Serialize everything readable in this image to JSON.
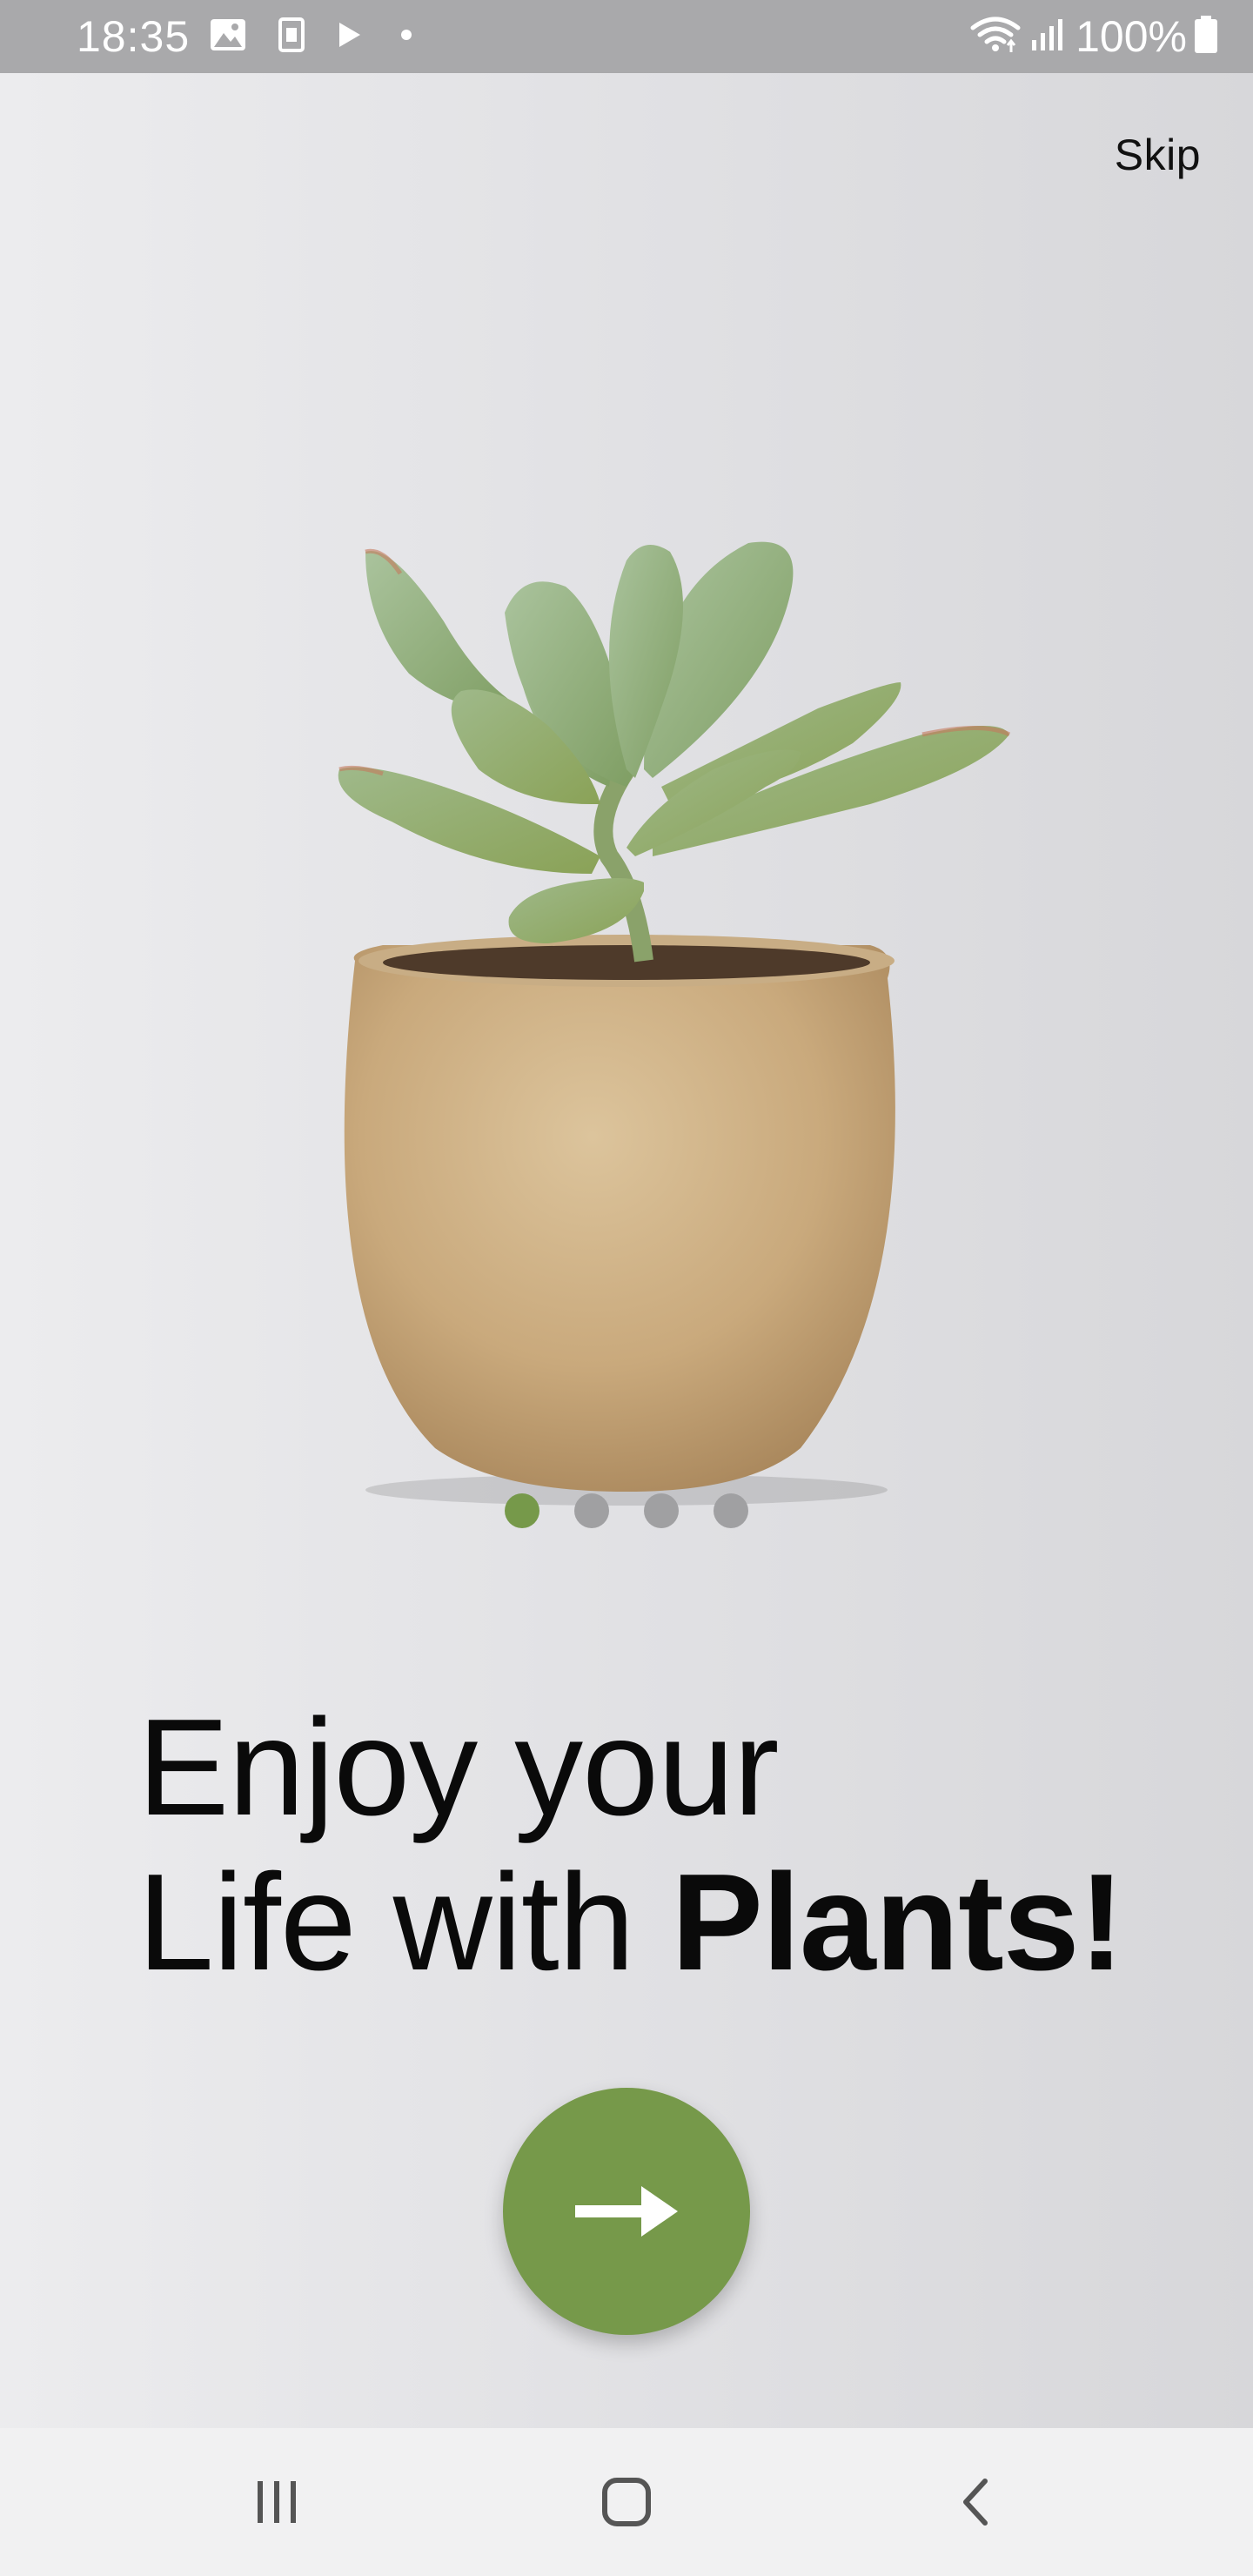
{
  "status_bar": {
    "time": "18:35",
    "battery": "100%",
    "icons": [
      "gallery-icon",
      "notification-app-icon",
      "play-icon",
      "dot-icon",
      "wifi-icon",
      "signal-icon",
      "battery-icon"
    ]
  },
  "onboarding": {
    "skip_label": "Skip",
    "headline_line1": "Enjoy your",
    "headline_line2_regular": "Life with ",
    "headline_line2_bold": "Plants!",
    "pager": {
      "total": 4,
      "active": 1
    },
    "next_icon": "arrow-right-icon",
    "image": "succulent-in-pot"
  },
  "nav_bar": {
    "buttons": [
      "recent-apps-icon",
      "home-icon",
      "back-icon"
    ]
  },
  "colors": {
    "accent": "#76994a",
    "inactive_dot": "#a0a0a2",
    "status_bar": "#a9a9ab",
    "nav_bar": "#f1f1f2",
    "text": "#0a0a0a"
  }
}
